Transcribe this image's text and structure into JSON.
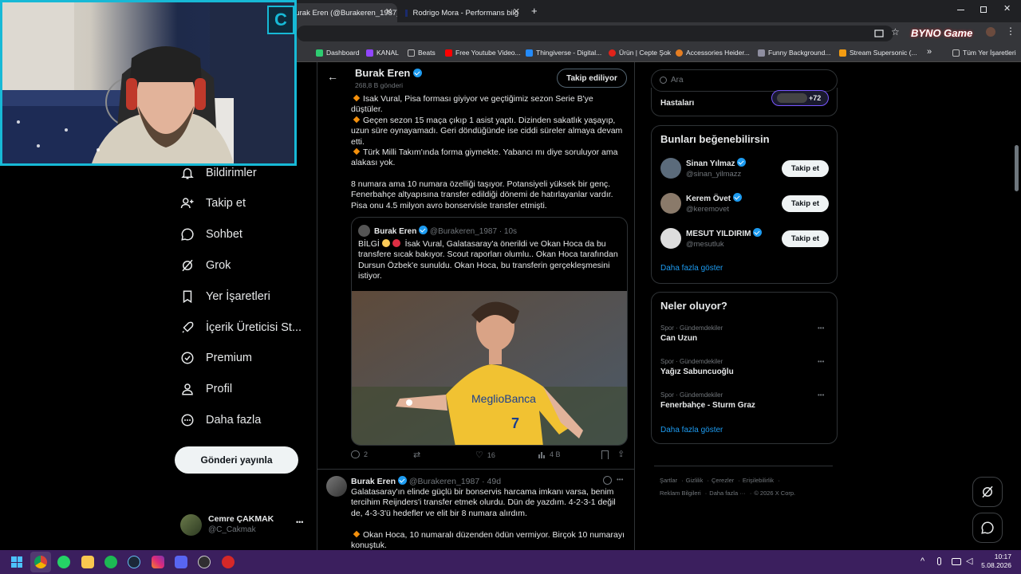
{
  "browser": {
    "tabs": [
      {
        "title": "Burak Eren (@Burakeren_1987)"
      },
      {
        "title": "Rodrigo Mora - Performans bilg"
      }
    ],
    "new_tab": "+",
    "bookmarks": [
      {
        "label": "Dashboard",
        "color": "#2ecc71"
      },
      {
        "label": "KANAL",
        "color": "#9146ff"
      },
      {
        "label": "Beats",
        "color": "#888888"
      },
      {
        "label": "Free Youtube Video...",
        "color": "#ff0000"
      },
      {
        "label": "Thingiverse - Digital...",
        "color": "#248bfb"
      },
      {
        "label": "Ürün | Cepte Şok",
        "color": "#e2231a"
      },
      {
        "label": "Accessories Heider...",
        "color": "#e67e22"
      },
      {
        "label": "Funny Background...",
        "color": "#8e8ea0"
      },
      {
        "label": "Stream Supersonic (...",
        "color": "#f39c12"
      }
    ],
    "bookmarks_more": "»",
    "all_bookmarks": "Tüm Yer İşaretleri",
    "overlay_logo": "BYNO Game"
  },
  "webcam_logo": "C",
  "nav": {
    "items": [
      {
        "label": "Bildirimler"
      },
      {
        "label": "Takip et"
      },
      {
        "label": "Sohbet"
      },
      {
        "label": "Grok"
      },
      {
        "label": "Yer İşaretleri"
      },
      {
        "label": "İçerik Üreticisi St..."
      },
      {
        "label": "Premium"
      },
      {
        "label": "Profil"
      },
      {
        "label": "Daha fazla"
      }
    ],
    "post_button": "Gönderi yayınla",
    "account": {
      "name": "Cemre ÇAKMAK",
      "handle": "@C_Cakmak",
      "more": "•••"
    }
  },
  "header": {
    "back": "←",
    "name": "Burak Eren",
    "posts": "268,8 B gönderi",
    "follow_state": "Takip ediliyor"
  },
  "tweet": {
    "p1": "Isak Vural, Pisa forması giyiyor ve geçtiğimiz sezon Serie B'ye düştüler.",
    "p2": "Geçen sezon 15 maça çıkıp 1 asist yaptı. Dizinden sakatlık yaşayıp, uzun süre oynayamadı. Geri döndüğünde ise ciddi süreler almaya devam etti.",
    "p3": "Türk Milli Takım'ında forma giymekte. Yabancı mı diye soruluyor ama alakası yok.",
    "p4": "8 numara ama 10 numara özelliği taşıyor. Potansiyeli yüksek bir genç. Fenerbahçe altyapısına transfer edildiği dönemi de hatırlayanlar vardır. Pisa onu 4.5 milyon avro bonservisle transfer etmişti.",
    "quote": {
      "name": "Burak Eren",
      "handle": "@Burakeren_1987",
      "time": "· 10s",
      "text_prefix": "BİLGİ",
      "text": "İsak Vural, Galatasaray'a önerildi ve Okan Hoca da bu transfere sıcak bakıyor. Scout raporları olumlu.. Okan Hoca tarafından Dursun Özbek'e sunuldu. Okan Hoca, bu transferin gerçekleşmesini istiyor.",
      "image_sponsor": "MeglioBanca",
      "image_number": "7"
    },
    "stats": {
      "replies": "2",
      "retweets": "",
      "likes": "16",
      "views": "4 B"
    }
  },
  "tweet2": {
    "name": "Burak Eren",
    "handle": "@Burakeren_1987",
    "time": "· 49d",
    "more": "•••",
    "p1": "Galatasaray'ın elinde güçlü bir bonservis harcama imkanı varsa, benim tercihim Reijnders'i transfer etmek olurdu. Dün de yazdım. 4-2-3-1 değil de, 4-3-3'ü hedefler ve elit bir 8 numara alırdım.",
    "p2": "Okan Hoca, 10 numaralı düzenden ödün vermiyor. Birçok 10 numarayı konuştuk."
  },
  "right": {
    "search_placeholder": "Ara",
    "top_partial_title": "Hastaları",
    "top_partial_badge": "+72",
    "suggest_title": "Bunları beğenebilirsin",
    "suggestions": [
      {
        "name": "Sinan Yılmaz",
        "handle": "@sinan_yilmazz",
        "button": "Takip et"
      },
      {
        "name": "Kerem Övet",
        "handle": "@keremovet",
        "button": "Takip et"
      },
      {
        "name": "MESUT YILDIRIM",
        "handle": "@mesutluk",
        "button": "Takip et"
      }
    ],
    "show_more": "Daha fazla göster",
    "trends_title": "Neler oluyor?",
    "trends": [
      {
        "category": "Spor · Gündemdekiler",
        "name": "Can Uzun"
      },
      {
        "category": "Spor · Gündemdekiler",
        "name": "Yağız Sabuncuoğlu"
      },
      {
        "category": "Spor · Gündemdekiler",
        "name": "Fenerbahçe - Sturm Graz"
      }
    ],
    "trend_more": "•••",
    "show_more2": "Daha fazla göster",
    "footer_line1": [
      "Şartlar",
      "Gizlilik",
      "Çerezler",
      "Erişilebilirlik"
    ],
    "footer_line2": [
      "Reklam Bilgileri",
      "Daha fazla ···",
      "© 2026 X Corp."
    ]
  },
  "taskbar": {
    "time": "10:17",
    "date": "5.08.2026",
    "up_arrow": "^"
  }
}
